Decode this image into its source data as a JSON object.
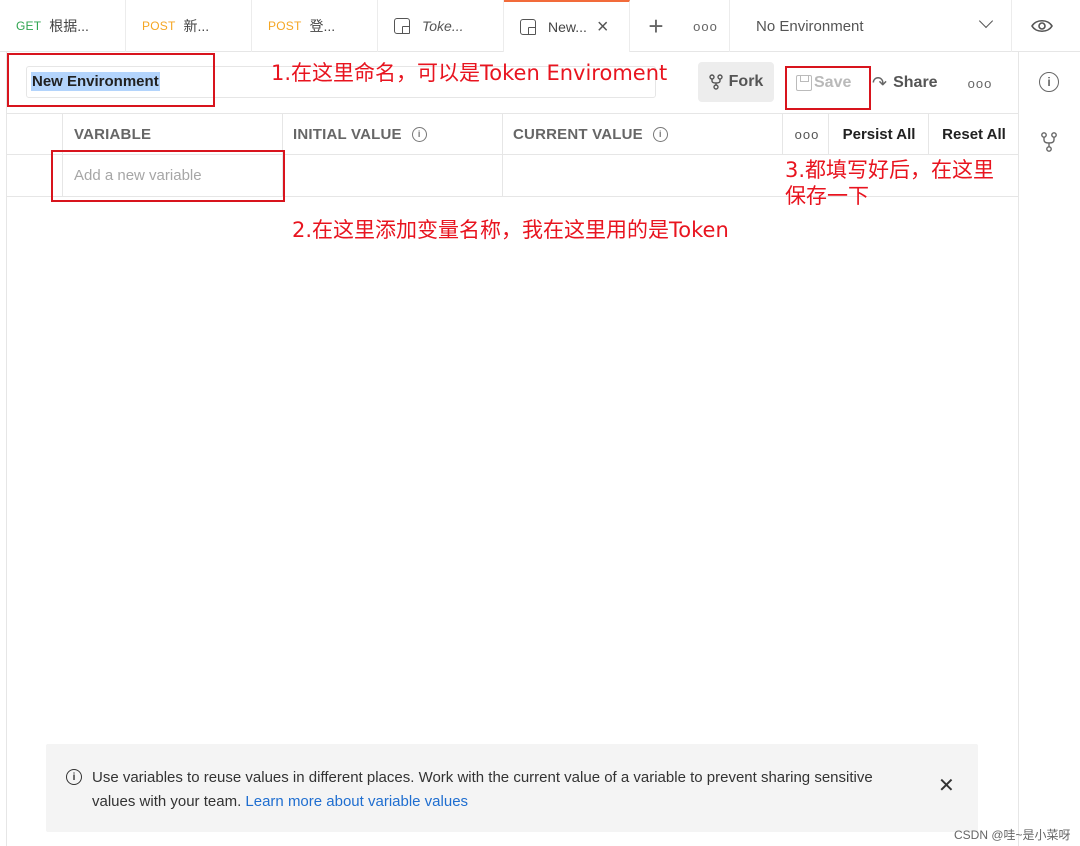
{
  "tabs": [
    {
      "method": "GET",
      "name": "根据..."
    },
    {
      "method": "POST",
      "name": "新..."
    },
    {
      "method": "POST",
      "name": "登..."
    },
    {
      "method": "",
      "name": "Toke..."
    },
    {
      "method": "",
      "name": "New..."
    }
  ],
  "tabbar": {
    "plus": "+",
    "more": "ooo",
    "environment_select": "No Environment"
  },
  "env": {
    "name_value": "New Environment"
  },
  "toolbar": {
    "fork_label": "Fork",
    "save_label": "Save",
    "share_label": "Share",
    "more": "ooo"
  },
  "table": {
    "columns": [
      "VARIABLE",
      "INITIAL VALUE",
      "CURRENT VALUE"
    ],
    "more": "ooo",
    "persist_all": "Persist All",
    "reset_all": "Reset All",
    "add_placeholder": "Add a new variable"
  },
  "annotations": {
    "note1": "1.在这里命名，可以是Token Enviroment",
    "note2": "2.在这里添加变量名称，我在这里用的是Token",
    "note3_line1": "3.都填写好后，在这里",
    "note3_line2": "保存一下"
  },
  "notice": {
    "text": "Use variables to reuse values in different places. Work with the current value of a variable to prevent sharing sensitive values with your team. ",
    "link": "Learn more about variable values"
  },
  "watermark": "CSDN @哇~是小菜呀",
  "colors": {
    "active_tab_accent": "#f26b3a",
    "get_method": "#2fa44f",
    "post_method": "#f5a623",
    "annotation_red": "#e8141f",
    "link_blue": "#1f6ed0"
  }
}
